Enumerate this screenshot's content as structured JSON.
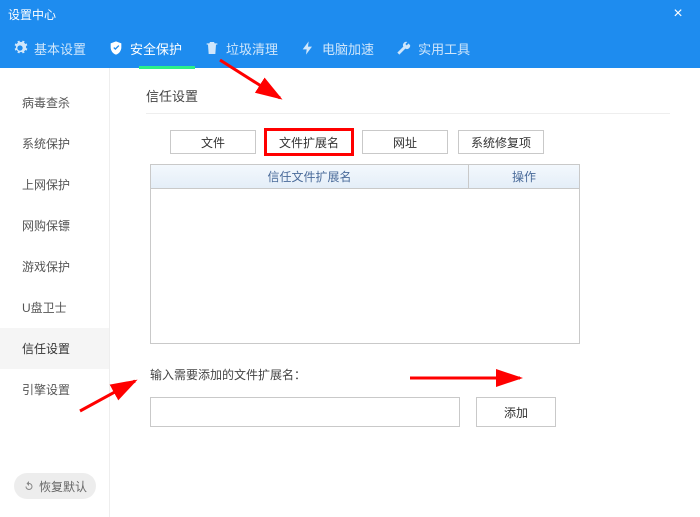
{
  "window": {
    "title": "设置中心"
  },
  "topnav": {
    "items": [
      {
        "label": "基本设置",
        "icon": "gear"
      },
      {
        "label": "安全保护",
        "icon": "shield",
        "active": true
      },
      {
        "label": "垃圾清理",
        "icon": "trash"
      },
      {
        "label": "电脑加速",
        "icon": "bolt"
      },
      {
        "label": "实用工具",
        "icon": "wrench"
      }
    ]
  },
  "sidebar": {
    "items": [
      {
        "label": "病毒查杀"
      },
      {
        "label": "系统保护"
      },
      {
        "label": "上网保护"
      },
      {
        "label": "网购保镖"
      },
      {
        "label": "游戏保护"
      },
      {
        "label": "U盘卫士"
      },
      {
        "label": "信任设置",
        "active": true
      },
      {
        "label": "引擎设置"
      }
    ],
    "restore_label": "恢复默认"
  },
  "main": {
    "section_title": "信任设置",
    "tabs": [
      {
        "label": "文件"
      },
      {
        "label": "文件扩展名",
        "highlight": true
      },
      {
        "label": "网址"
      },
      {
        "label": "系统修复项"
      }
    ],
    "list_headers": {
      "col1": "信任文件扩展名",
      "col2": "操作"
    },
    "input_prompt": "输入需要添加的文件扩展名：",
    "input_value": "",
    "input_placeholder": "",
    "add_button": "添加"
  }
}
